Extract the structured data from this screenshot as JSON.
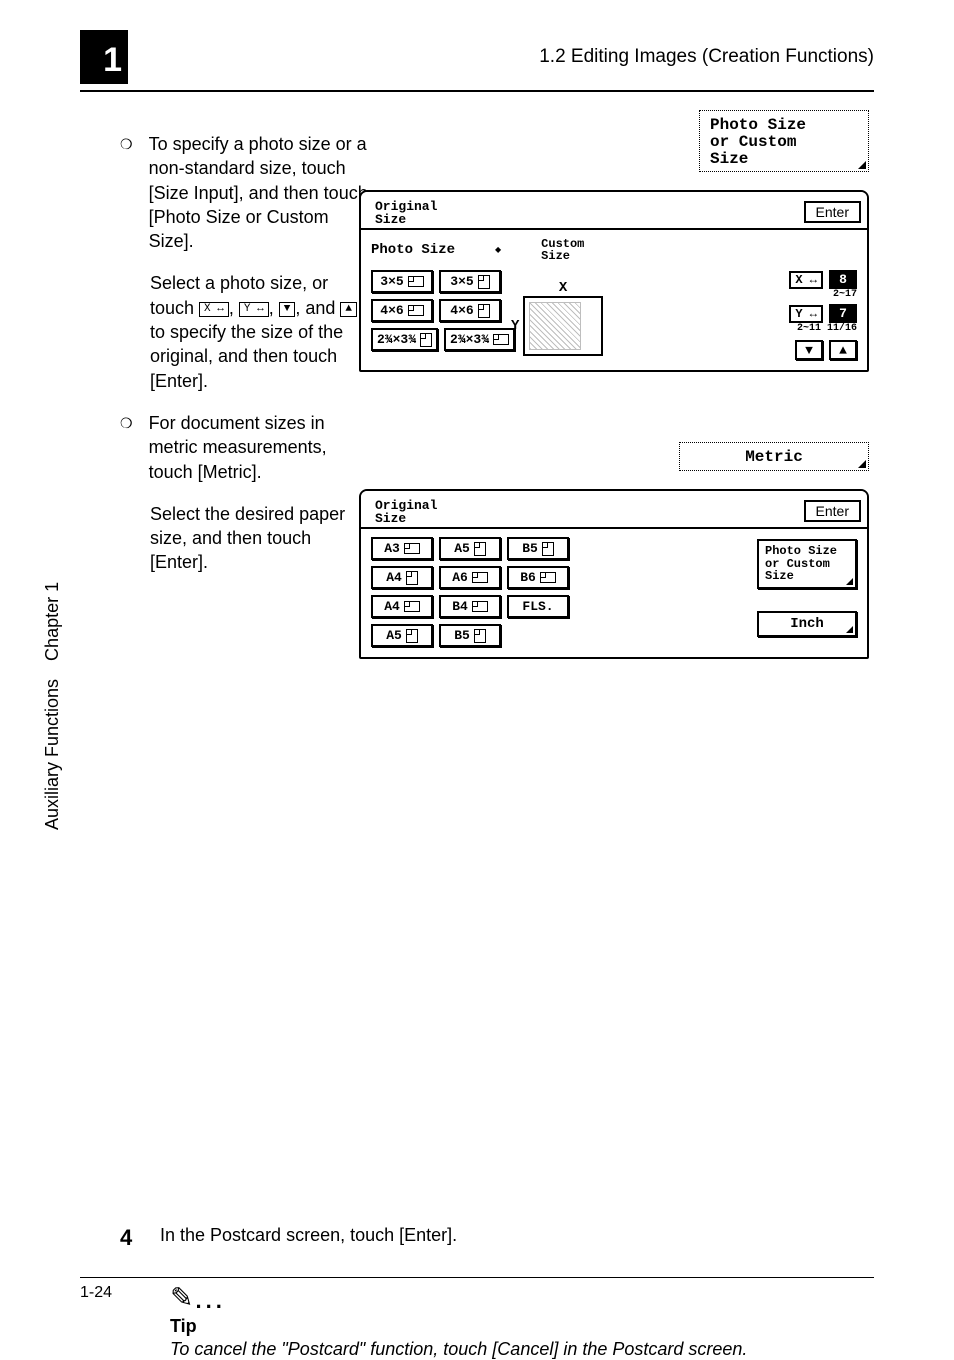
{
  "header": {
    "chapter_num": "1",
    "section_title": "1.2 Editing Images (Creation Functions)"
  },
  "side": {
    "chapter_label": "Chapter 1",
    "aux_label": "Auxiliary Functions"
  },
  "bullets": {
    "b1": "To specify a photo size or a non-standard size, touch [Size Input], and then touch [Photo Size or Custom Size].",
    "b1_para_a": "Select a photo size, or touch ",
    "b1_para_b": " to specify the size of the original, and then touch [Enter].",
    "b1_inline_comma": ", ",
    "b1_inline_and": ", and ",
    "b2": "For document sizes in metric measurements, touch [Metric].",
    "b2_para": "Select the desired paper size, and then touch [Enter]."
  },
  "callouts": {
    "photo_custom": "Photo Size\nor Custom\nSize",
    "metric": "Metric"
  },
  "panel1": {
    "tab": "Original\nSize",
    "enter": "Enter",
    "photo_label": "Photo Size",
    "custom_label": "Custom\nSize",
    "btns": {
      "a": "3×5",
      "b": "3×5",
      "c": "4×6",
      "d": "4×6",
      "e": "2¾×3¾",
      "f": "2¾×3¾"
    },
    "xy": {
      "xkey": "X ↔",
      "xval": "8",
      "xrange": "2~17",
      "ykey": "Y ↔",
      "yval": "7",
      "yrange": "2~11 11/16"
    }
  },
  "panel2": {
    "tab": "Original\nSize",
    "enter": "Enter",
    "grid": [
      [
        "A3",
        "A5",
        "B5"
      ],
      [
        "A4",
        "A6",
        "B6"
      ],
      [
        "A4",
        "B4",
        "FLS."
      ],
      [
        "A5",
        "B5"
      ]
    ],
    "side_photo": "Photo Size\nor Custom\nSize",
    "side_inch": "Inch"
  },
  "step4": {
    "num": "4",
    "text": "In the Postcard screen, touch [Enter]."
  },
  "tip": {
    "label": "Tip",
    "text": "To cancel the \"Postcard\" function, touch [Cancel] in the Postcard screen."
  },
  "footer": {
    "page": "1-24"
  },
  "icons": {
    "x": "X ↔",
    "y": "Y ↔",
    "down": "▼",
    "up": "▲"
  }
}
